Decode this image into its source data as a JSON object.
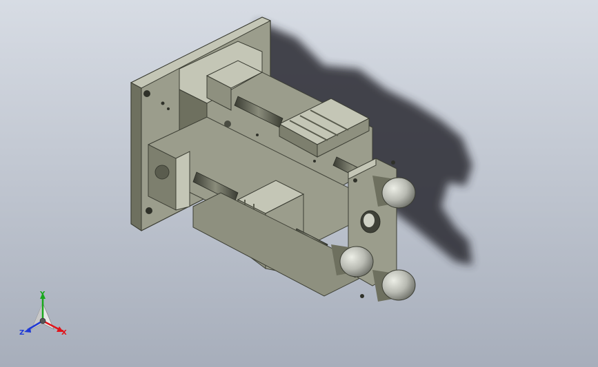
{
  "viewport": {
    "background_top": "#d7dce4",
    "background_bottom": "#a7aebb"
  },
  "model": {
    "body_color": "#9b9d8c",
    "body_light": "#c4c6b6",
    "body_dark": "#6e705f",
    "knob_color": "#b8bab2",
    "shadow_color": "#2a2c30"
  },
  "triad": {
    "x_label": "X",
    "y_label": "Y",
    "z_label": "Z",
    "x_color": "#e0141b",
    "y_color": "#19a81c",
    "z_color": "#1f3ad6"
  }
}
